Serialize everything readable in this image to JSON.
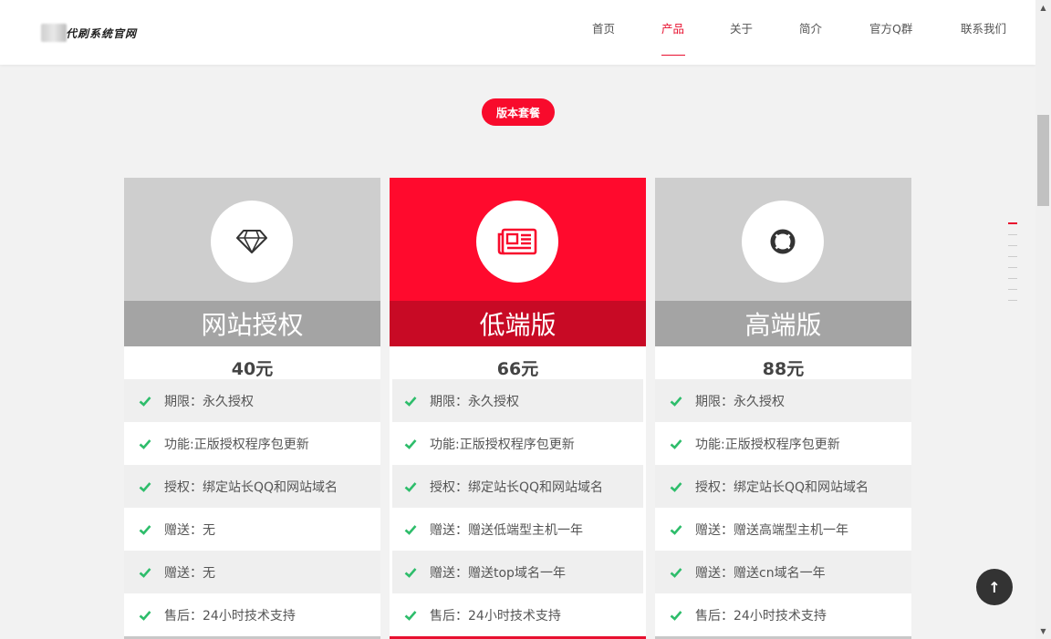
{
  "header": {
    "logo_text": "代刷系统官网",
    "nav": [
      {
        "label": "首页"
      },
      {
        "label": "产品"
      },
      {
        "label": "关于"
      },
      {
        "label": "简介"
      },
      {
        "label": "官方Q群"
      },
      {
        "label": "联系我们"
      }
    ],
    "active_nav": "产品"
  },
  "section_badge": "版本套餐",
  "cards": [
    {
      "icon": "diamond-icon",
      "title": "网站授权",
      "price": "40元",
      "features": [
        "期限：永久授权",
        "功能:正版授权程序包更新",
        "授权：绑定站长QQ和网站域名",
        "赠送：无",
        "赠送：无",
        "售后：24小时技术支持"
      ]
    },
    {
      "icon": "newspaper-icon",
      "title": "低端版",
      "price": "66元",
      "featured": true,
      "features": [
        "期限：永久授权",
        "功能:正版授权程序包更新",
        "授权：绑定站长QQ和网站域名",
        "赠送：赠送低端型主机一年",
        "赠送：赠送top域名一年",
        "售后：24小时技术支持"
      ]
    },
    {
      "icon": "life-ring-icon",
      "title": "高端版",
      "price": "88元",
      "features": [
        "期限：永久授权",
        "功能:正版授权程序包更新",
        "授权：绑定站长QQ和网站域名",
        "赠送：赠送高端型主机一年",
        "赠送：赠送cn域名一年",
        "售后：24小时技术支持"
      ]
    }
  ],
  "back_to_top": "↑",
  "colors": {
    "accent": "#f80b2c",
    "check": "#2ebd6b",
    "card_header_gray": "#cecece",
    "title_bar_gray": "#a4a4a4"
  }
}
